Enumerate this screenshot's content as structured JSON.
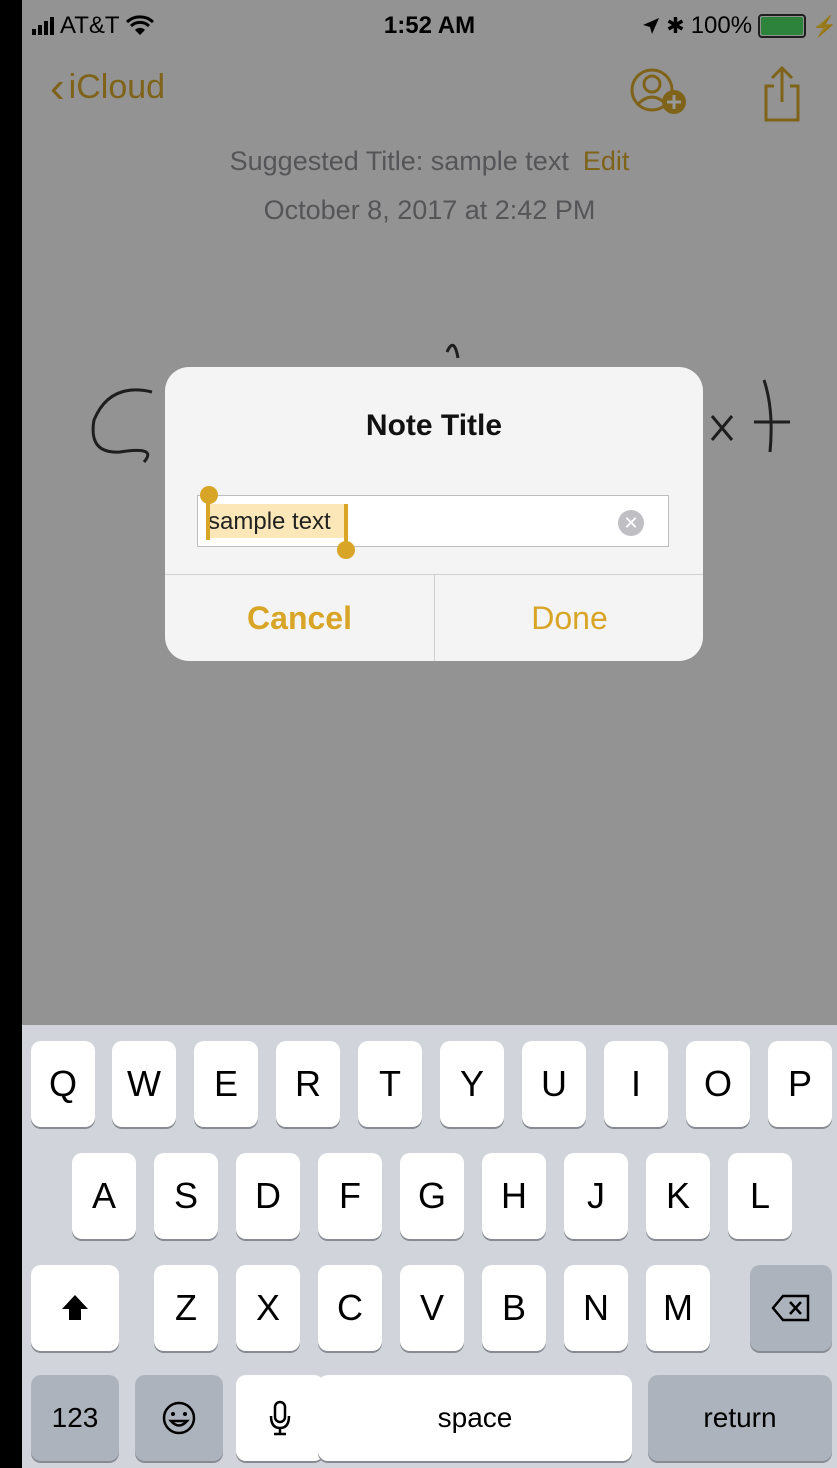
{
  "status_bar": {
    "carrier": "AT&T",
    "time": "1:52 AM",
    "battery_percent": "100%",
    "battery_level": 1.0
  },
  "nav": {
    "back_label": "iCloud",
    "add_person_icon": "add-person-icon",
    "share_icon": "share-icon"
  },
  "note": {
    "suggested_title": "Suggested Title: sample text",
    "edit_label": "Edit",
    "date": "October 8, 2017 at 2:42 PM"
  },
  "alert": {
    "title": "Note Title",
    "field_value": "sample text",
    "cancel_label": "Cancel",
    "done_label": "Done"
  },
  "keyboard": {
    "row1": [
      "Q",
      "W",
      "E",
      "R",
      "T",
      "Y",
      "U",
      "I",
      "O",
      "P"
    ],
    "row2": [
      "A",
      "S",
      "D",
      "F",
      "G",
      "H",
      "J",
      "K",
      "L"
    ],
    "row3": [
      "Z",
      "X",
      "C",
      "V",
      "B",
      "N",
      "M"
    ],
    "numbers_label": "123",
    "space_label": "space",
    "return_label": "return"
  },
  "colors": {
    "accent": "#d9a526",
    "keyboard_bg": "#d1d4da"
  }
}
